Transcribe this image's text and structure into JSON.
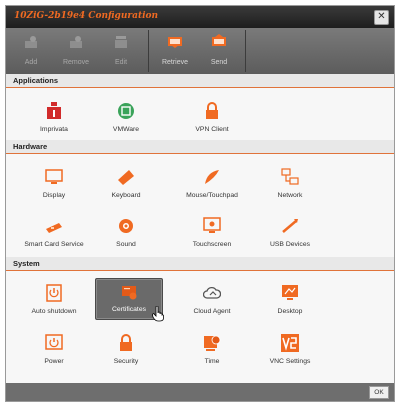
{
  "window": {
    "title": "10ZiG-2b19e4 Configuration",
    "close_glyph": "✕"
  },
  "toolbar": {
    "add": "Add",
    "remove": "Remove",
    "edit": "Edit",
    "retrieve": "Retrieve",
    "send": "Send"
  },
  "sections": {
    "applications": "Applications",
    "hardware": "Hardware",
    "system": "System"
  },
  "applications": [
    "Imprivata",
    "VMWare",
    "VPN Client"
  ],
  "hardware": [
    "Display",
    "Keyboard",
    "Mouse/Touchpad",
    "Network",
    "Smart Card Service",
    "Sound",
    "Touchscreen",
    "USB Devices"
  ],
  "system": [
    "Auto shutdown",
    "Certificates",
    "Cloud Agent",
    "Desktop",
    "Power",
    "Security",
    "Time",
    "VNC Settings"
  ],
  "footer": {
    "ok": "OK"
  },
  "colors": {
    "accent": "#f06a22",
    "vmware_green": "#3aa35a",
    "imprivata_red": "#d12b2b",
    "section_line": "#e0733a"
  }
}
